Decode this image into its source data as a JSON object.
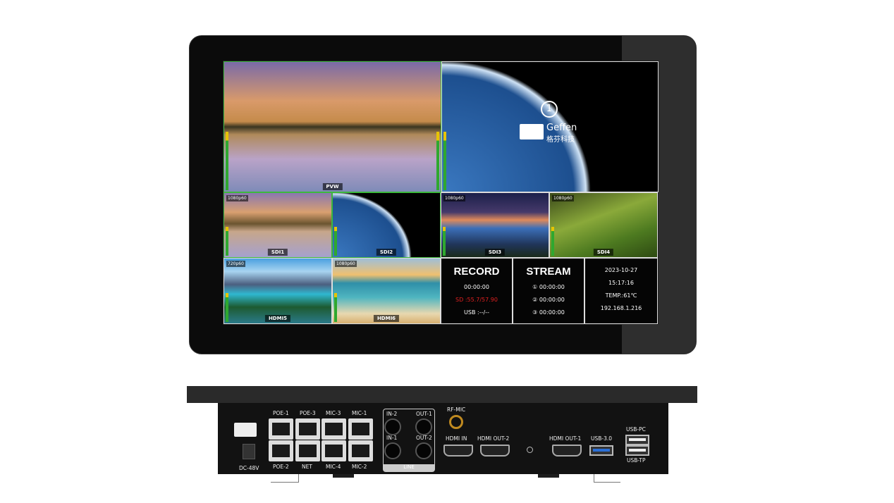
{
  "monitor": {
    "pvw_label": "PVW",
    "pgm": {
      "number": "1",
      "brand": "Geffen",
      "brand_cn": "格芬科技"
    },
    "tiles": [
      {
        "label": "SDI1",
        "format": "1080p60"
      },
      {
        "label": "SDI2",
        "format": ""
      },
      {
        "label": "SDI3",
        "format": "1080p60"
      },
      {
        "label": "SDI4",
        "format": "1080p60"
      },
      {
        "label": "HDMI5",
        "format": "720p60"
      },
      {
        "label": "HDMI6",
        "format": "1080p60"
      }
    ],
    "record": {
      "title": "RECORD",
      "time": "00:00:00",
      "sd": "SD :55.7/57.90",
      "usb": "USB :--/--"
    },
    "stream": {
      "title": "STREAM",
      "lines": [
        "① 00:00:00",
        "② 00:00:00",
        "③ 00:00:00"
      ]
    },
    "status": {
      "date": "2023-10-27",
      "time": "15:17:16",
      "temp": "TEMP.:61℃",
      "ip": "192.168.1.216"
    }
  },
  "rear_panel": {
    "rj45_top": [
      "POE-1",
      "POE-3",
      "MIC-3",
      "MIC-1"
    ],
    "rj45_bottom": [
      "POE-2",
      "NET",
      "MIC-4",
      "MIC-2"
    ],
    "power": "DC-48V",
    "line": {
      "in2": "IN-2",
      "out1": "OUT-1",
      "in1": "IN-1",
      "out2": "OUT-2",
      "group": "LINE"
    },
    "rf_mic": "RF-MIC",
    "hdmi_in": "HDMI IN",
    "hdmi_out2": "HDMI OUT-2",
    "hdmi_out1": "HDMI OUT-1",
    "usb3": "USB-3.0",
    "usb_pc": "USB-PC",
    "usb_tp": "USB-TP"
  },
  "colors": {
    "tally_green": "#3cb83c",
    "sd_red": "#e02020",
    "usb3_blue": "#2a6fd6"
  }
}
